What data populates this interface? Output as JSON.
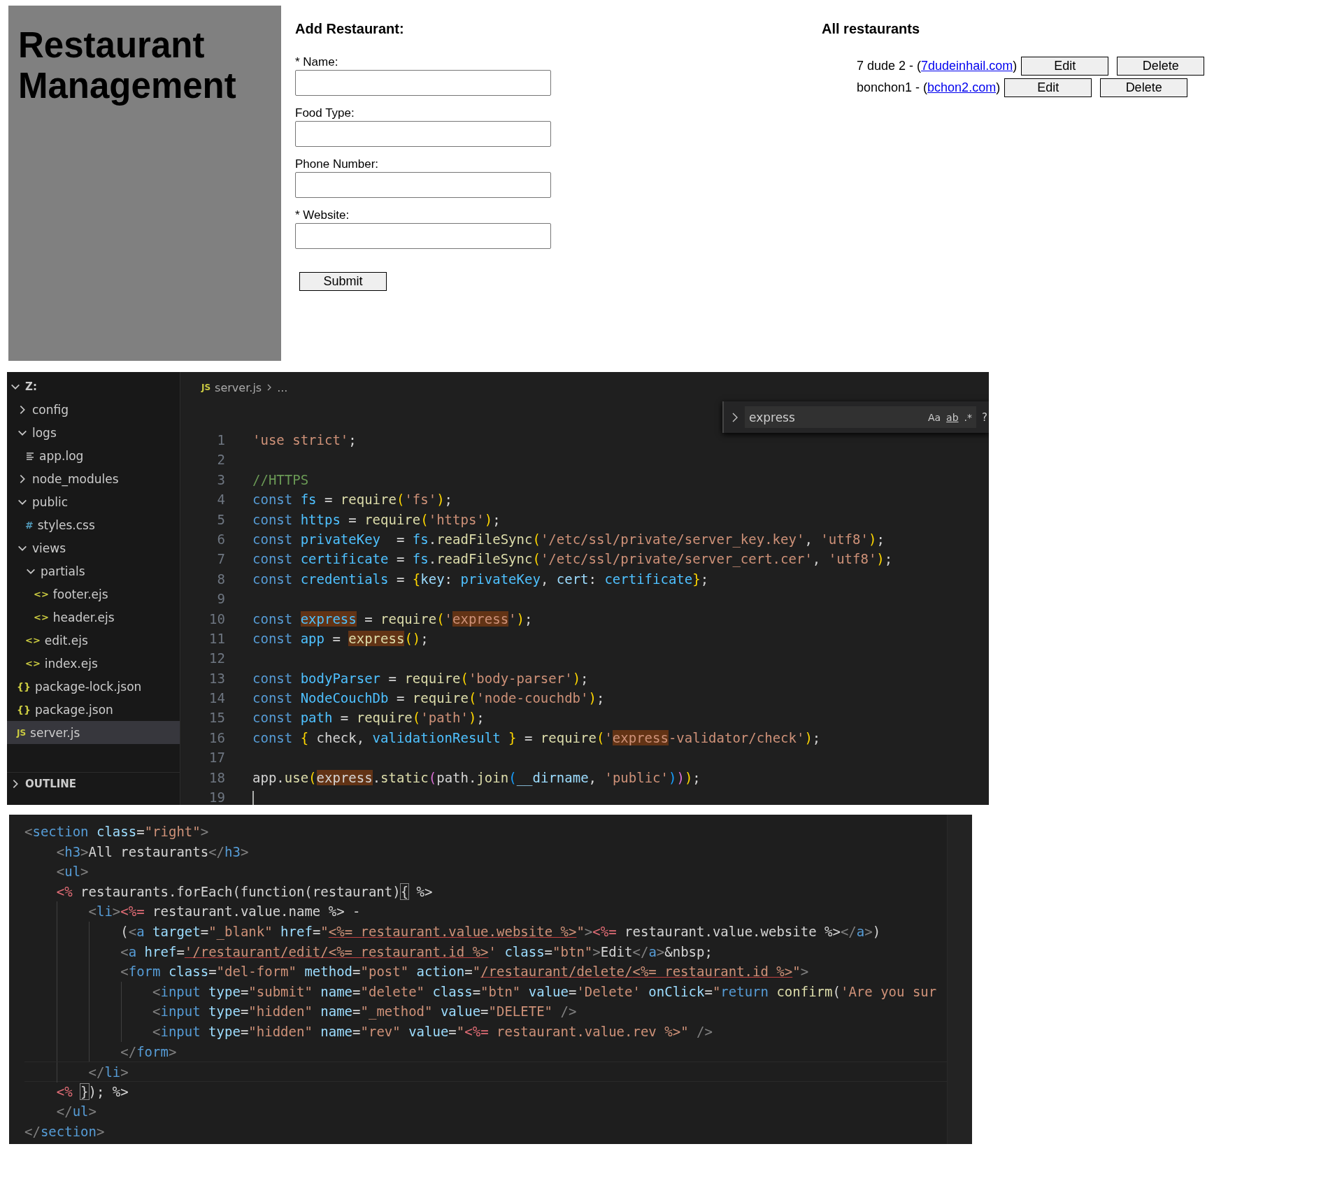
{
  "page": {
    "title": "Restaurant Management",
    "add_form": {
      "heading": "Add Restaurant:",
      "fields": [
        {
          "label": "* Name:"
        },
        {
          "label": "Food Type:"
        },
        {
          "label": "Phone Number:"
        },
        {
          "label": "* Website:"
        }
      ],
      "submit": "Submit"
    },
    "restaurants": {
      "heading": "All restaurants",
      "items": [
        {
          "label": "7 dude 2 - (",
          "website": "7dudeinhail.com",
          "suffix": ")",
          "edit": "Edit",
          "delete": "Delete"
        },
        {
          "label": "bonchon1 - (",
          "website": "bchon2.com",
          "suffix": ")",
          "edit": "Edit",
          "delete": "Delete"
        }
      ]
    }
  },
  "editor": {
    "explorer": {
      "root": {
        "label": "Z:",
        "expanded": true
      },
      "items": [
        {
          "label": "config",
          "kind": "folder",
          "expanded": false,
          "selected": false
        },
        {
          "label": "logs",
          "kind": "folder",
          "expanded": true,
          "selected": false,
          "children": [
            {
              "label": "app.log",
              "kind": "log",
              "selected": false
            }
          ]
        },
        {
          "label": "node_modules",
          "kind": "folder",
          "expanded": false,
          "selected": false
        },
        {
          "label": "public",
          "kind": "folder",
          "expanded": true,
          "selected": false,
          "children": [
            {
              "label": "styles.css",
              "kind": "css",
              "glyph": "#",
              "selected": false
            }
          ]
        },
        {
          "label": "views",
          "kind": "folder",
          "expanded": true,
          "selected": false,
          "children": [
            {
              "label": "partials",
              "kind": "folder",
              "expanded": true,
              "selected": false,
              "children": [
                {
                  "label": "footer.ejs",
                  "kind": "ejs",
                  "glyph": "<>",
                  "selected": false
                },
                {
                  "label": "header.ejs",
                  "kind": "ejs",
                  "glyph": "<>",
                  "selected": false
                }
              ]
            },
            {
              "label": "edit.ejs",
              "kind": "ejs",
              "glyph": "<>",
              "selected": false
            },
            {
              "label": "index.ejs",
              "kind": "ejs",
              "glyph": "<>",
              "selected": false
            }
          ]
        },
        {
          "label": "package-lock.json",
          "kind": "json",
          "glyph": "{}",
          "selected": false
        },
        {
          "label": "package.json",
          "kind": "json",
          "glyph": "{}",
          "selected": false
        },
        {
          "label": "server.js",
          "kind": "js",
          "glyph": "JS",
          "selected": true
        }
      ],
      "outline": {
        "label": "OUTLINE",
        "expanded": false
      }
    },
    "breadcrumb": {
      "glyph": "JS",
      "file": "server.js",
      "rest": "..."
    },
    "find": {
      "query": "express",
      "options": [
        {
          "label": "Aa",
          "kind": "case"
        },
        {
          "label": "ab",
          "kind": "word"
        },
        {
          "label": ".*",
          "kind": "regex"
        }
      ],
      "result": "?"
    },
    "lines": [
      {
        "n": "1",
        "tokens": [
          {
            "text": "'use strict'",
            "kind": "str"
          },
          {
            "text": ";",
            "kind": "pl"
          }
        ]
      },
      {
        "n": "2"
      },
      {
        "n": "3",
        "tokens": [
          {
            "text": "//HTTPS",
            "kind": "cm"
          }
        ]
      },
      {
        "n": "4",
        "tokens": [
          {
            "text": "const",
            "kind": "kw"
          },
          {
            "text": " fs",
            "kind": "var"
          },
          {
            "text": " = ",
            "kind": "pl"
          },
          {
            "text": "require",
            "kind": "fn"
          },
          {
            "text": "(",
            "kind": "p1"
          },
          {
            "text": "'fs'",
            "kind": "str"
          },
          {
            "text": ")",
            "kind": "p1"
          },
          {
            "text": ";",
            "kind": "pl"
          }
        ]
      },
      {
        "n": "5",
        "tokens": [
          {
            "text": "const",
            "kind": "kw"
          },
          {
            "text": " https",
            "kind": "var"
          },
          {
            "text": " = ",
            "kind": "pl"
          },
          {
            "text": "require",
            "kind": "fn"
          },
          {
            "text": "(",
            "kind": "p1"
          },
          {
            "text": "'https'",
            "kind": "str"
          },
          {
            "text": ")",
            "kind": "p1"
          },
          {
            "text": ";",
            "kind": "pl"
          }
        ]
      },
      {
        "n": "6",
        "tokens": [
          {
            "text": "const",
            "kind": "kw"
          },
          {
            "text": " privateKey",
            "kind": "var"
          },
          {
            "text": "  = ",
            "kind": "pl"
          },
          {
            "text": "fs",
            "kind": "var"
          },
          {
            "text": ".",
            "kind": "pl"
          },
          {
            "text": "readFileSync",
            "kind": "fn"
          },
          {
            "text": "(",
            "kind": "p1"
          },
          {
            "text": "'/etc/ssl/private/server_key.key'",
            "kind": "str"
          },
          {
            "text": ", ",
            "kind": "pl"
          },
          {
            "text": "'utf8'",
            "kind": "str"
          },
          {
            "text": ")",
            "kind": "p1"
          },
          {
            "text": ";",
            "kind": "pl"
          }
        ]
      },
      {
        "n": "7",
        "tokens": [
          {
            "text": "const",
            "kind": "kw"
          },
          {
            "text": " certificate",
            "kind": "var"
          },
          {
            "text": " = ",
            "kind": "pl"
          },
          {
            "text": "fs",
            "kind": "var"
          },
          {
            "text": ".",
            "kind": "pl"
          },
          {
            "text": "readFileSync",
            "kind": "fn"
          },
          {
            "text": "(",
            "kind": "p1"
          },
          {
            "text": "'/etc/ssl/private/server_cert.cer'",
            "kind": "str"
          },
          {
            "text": ", ",
            "kind": "pl"
          },
          {
            "text": "'utf8'",
            "kind": "str"
          },
          {
            "text": ")",
            "kind": "p1"
          },
          {
            "text": ";",
            "kind": "pl"
          }
        ]
      },
      {
        "n": "8",
        "tokens": [
          {
            "text": "const",
            "kind": "kw"
          },
          {
            "text": " credentials",
            "kind": "var"
          },
          {
            "text": " = ",
            "kind": "pl"
          },
          {
            "text": "{",
            "kind": "p1"
          },
          {
            "text": "key",
            "kind": "prop"
          },
          {
            "text": ": ",
            "kind": "pl"
          },
          {
            "text": "privateKey",
            "kind": "var"
          },
          {
            "text": ", ",
            "kind": "pl"
          },
          {
            "text": "cert",
            "kind": "prop"
          },
          {
            "text": ": ",
            "kind": "pl"
          },
          {
            "text": "certificate",
            "kind": "var"
          },
          {
            "text": "}",
            "kind": "p1"
          },
          {
            "text": ";",
            "kind": "pl"
          }
        ]
      },
      {
        "n": "9"
      },
      {
        "n": "10",
        "tokens": [
          {
            "text": "const ",
            "kind": "kw"
          },
          {
            "text": "express",
            "kind": "var-hl"
          },
          {
            "text": " = ",
            "kind": "pl"
          },
          {
            "text": "require",
            "kind": "fn"
          },
          {
            "text": "(",
            "kind": "p1"
          },
          {
            "text": "'",
            "kind": "str"
          },
          {
            "text": "express",
            "kind": "str-hl"
          },
          {
            "text": "'",
            "kind": "str"
          },
          {
            "text": ")",
            "kind": "p1"
          },
          {
            "text": ";",
            "kind": "pl"
          }
        ]
      },
      {
        "n": "11",
        "tokens": [
          {
            "text": "const",
            "kind": "kw"
          },
          {
            "text": " app",
            "kind": "var"
          },
          {
            "text": " = ",
            "kind": "pl"
          },
          {
            "text": "express",
            "kind": "fn-hl"
          },
          {
            "text": "()",
            "kind": "p1"
          },
          {
            "text": ";",
            "kind": "pl"
          }
        ]
      },
      {
        "n": "12"
      },
      {
        "n": "13",
        "tokens": [
          {
            "text": "const",
            "kind": "kw"
          },
          {
            "text": " bodyParser",
            "kind": "var"
          },
          {
            "text": " = ",
            "kind": "pl"
          },
          {
            "text": "require",
            "kind": "fn"
          },
          {
            "text": "(",
            "kind": "p1"
          },
          {
            "text": "'body-parser'",
            "kind": "str"
          },
          {
            "text": ")",
            "kind": "p1"
          },
          {
            "text": ";",
            "kind": "pl"
          }
        ]
      },
      {
        "n": "14",
        "tokens": [
          {
            "text": "const",
            "kind": "kw"
          },
          {
            "text": " NodeCouchDb",
            "kind": "var"
          },
          {
            "text": " = ",
            "kind": "pl"
          },
          {
            "text": "require",
            "kind": "fn"
          },
          {
            "text": "(",
            "kind": "p1"
          },
          {
            "text": "'node-couchdb'",
            "kind": "str"
          },
          {
            "text": ")",
            "kind": "p1"
          },
          {
            "text": ";",
            "kind": "pl"
          }
        ]
      },
      {
        "n": "15",
        "tokens": [
          {
            "text": "const",
            "kind": "kw"
          },
          {
            "text": " path",
            "kind": "var"
          },
          {
            "text": " = ",
            "kind": "pl"
          },
          {
            "text": "require",
            "kind": "fn"
          },
          {
            "text": "(",
            "kind": "p1"
          },
          {
            "text": "'path'",
            "kind": "str"
          },
          {
            "text": ")",
            "kind": "p1"
          },
          {
            "text": ";",
            "kind": "pl"
          }
        ]
      },
      {
        "n": "16",
        "tokens": [
          {
            "text": "const ",
            "kind": "kw"
          },
          {
            "text": "{",
            "kind": "p1"
          },
          {
            "text": " check, ",
            "kind": "pl"
          },
          {
            "text": "validationResult ",
            "kind": "var"
          },
          {
            "text": "}",
            "kind": "p1"
          },
          {
            "text": " = ",
            "kind": "pl"
          },
          {
            "text": "require",
            "kind": "fn"
          },
          {
            "text": "(",
            "kind": "p1"
          },
          {
            "text": "'",
            "kind": "str"
          },
          {
            "text": "express",
            "kind": "str-hl"
          },
          {
            "text": "-validator/check'",
            "kind": "str"
          },
          {
            "text": ")",
            "kind": "p1"
          },
          {
            "text": ";",
            "kind": "pl"
          }
        ]
      },
      {
        "n": "17"
      },
      {
        "n": "18",
        "tokens": [
          {
            "text": "app",
            "kind": "pl"
          },
          {
            "text": ".",
            "kind": "pl"
          },
          {
            "text": "use",
            "kind": "fn"
          },
          {
            "text": "(",
            "kind": "p1"
          },
          {
            "text": "express",
            "kind": "pl-hl"
          },
          {
            "text": ".",
            "kind": "pl"
          },
          {
            "text": "static",
            "kind": "fn"
          },
          {
            "text": "(",
            "kind": "p2"
          },
          {
            "text": "path",
            "kind": "pl"
          },
          {
            "text": ".",
            "kind": "pl"
          },
          {
            "text": "join",
            "kind": "fn"
          },
          {
            "text": "(",
            "kind": "p3"
          },
          {
            "text": "__dirname",
            "kind": "prop"
          },
          {
            "text": ", ",
            "kind": "pl"
          },
          {
            "text": "'public'",
            "kind": "str"
          },
          {
            "text": ")",
            "kind": "p3"
          },
          {
            "text": ")",
            "kind": "p2"
          },
          {
            "text": ")",
            "kind": "p1"
          },
          {
            "text": ";",
            "kind": "pl"
          }
        ]
      },
      {
        "n": "19"
      }
    ]
  },
  "template": {
    "lines": [
      {
        "current": false,
        "tokens": [
          {
            "text": "<",
            "kind": "tp"
          },
          {
            "text": "section",
            "kind": "tag"
          },
          {
            "text": " class",
            "kind": "attr"
          },
          {
            "text": "=",
            "kind": "pl"
          },
          {
            "text": "\"right\"",
            "kind": "str"
          },
          {
            "text": ">",
            "kind": "tp"
          }
        ]
      },
      {
        "current": false,
        "tokens": [
          {
            "text": "    <",
            "kind": "tp"
          },
          {
            "text": "h3",
            "kind": "tag"
          },
          {
            "text": ">",
            "kind": "tp"
          },
          {
            "text": "All restaurants",
            "kind": "pl"
          },
          {
            "text": "</",
            "kind": "tp"
          },
          {
            "text": "h3",
            "kind": "tag"
          },
          {
            "text": ">",
            "kind": "tp"
          }
        ]
      },
      {
        "current": false,
        "tokens": [
          {
            "text": "    <",
            "kind": "tp"
          },
          {
            "text": "ul",
            "kind": "tag"
          },
          {
            "text": ">",
            "kind": "tp"
          }
        ]
      },
      {
        "current": false,
        "tokens": [
          {
            "text": "    <%",
            "kind": "ejs"
          },
          {
            "text": " restaurants.forEach(function(restaurant)",
            "kind": "pl"
          },
          {
            "text": "{",
            "kind": "box"
          },
          {
            "text": " %>",
            "kind": "pl"
          }
        ]
      },
      {
        "current": false,
        "tokens": [
          {
            "text": "        <",
            "kind": "tp"
          },
          {
            "text": "li",
            "kind": "tag"
          },
          {
            "text": ">",
            "kind": "tp"
          },
          {
            "text": "<%=",
            "kind": "ejs"
          },
          {
            "text": " restaurant.value.name %> -",
            "kind": "pl"
          }
        ]
      },
      {
        "current": false,
        "tokens": [
          {
            "text": "            (",
            "kind": "pl"
          },
          {
            "text": "<",
            "kind": "tp"
          },
          {
            "text": "a",
            "kind": "tag"
          },
          {
            "text": " target",
            "kind": "attr"
          },
          {
            "text": "=",
            "kind": "pl"
          },
          {
            "text": "\"_blank\"",
            "kind": "str"
          },
          {
            "text": " href",
            "kind": "attr"
          },
          {
            "text": "=",
            "kind": "pl"
          },
          {
            "text": "\"",
            "kind": "str"
          },
          {
            "text": "<%= restaurant.value.website %>",
            "kind": "ejsstr"
          },
          {
            "text": "\"",
            "kind": "str"
          },
          {
            "text": ">",
            "kind": "tp"
          },
          {
            "text": "<%=",
            "kind": "ejs"
          },
          {
            "text": " restaurant.value.website %>",
            "kind": "pl"
          },
          {
            "text": "</",
            "kind": "tp"
          },
          {
            "text": "a",
            "kind": "tag"
          },
          {
            "text": ">",
            "kind": "tp"
          },
          {
            "text": ")",
            "kind": "pl"
          }
        ]
      },
      {
        "current": false,
        "tokens": [
          {
            "text": "            <",
            "kind": "tp"
          },
          {
            "text": "a",
            "kind": "tag"
          },
          {
            "text": " href",
            "kind": "attr"
          },
          {
            "text": "=",
            "kind": "pl"
          },
          {
            "text": "'/restaurant/edit/",
            "kind": "ustr"
          },
          {
            "text": "<%= restaurant.id %>",
            "kind": "ejsstr"
          },
          {
            "text": "'",
            "kind": "str"
          },
          {
            "text": " class",
            "kind": "attr"
          },
          {
            "text": "=",
            "kind": "pl"
          },
          {
            "text": "\"btn\"",
            "kind": "str"
          },
          {
            "text": ">",
            "kind": "tp"
          },
          {
            "text": "Edit",
            "kind": "pl"
          },
          {
            "text": "</",
            "kind": "tp"
          },
          {
            "text": "a",
            "kind": "tag"
          },
          {
            "text": ">",
            "kind": "tp"
          },
          {
            "text": "&nbsp;",
            "kind": "ent"
          }
        ]
      },
      {
        "current": false,
        "tokens": [
          {
            "text": "            <",
            "kind": "tp"
          },
          {
            "text": "form",
            "kind": "tag"
          },
          {
            "text": " class",
            "kind": "attr"
          },
          {
            "text": "=",
            "kind": "pl"
          },
          {
            "text": "\"del-form\"",
            "kind": "str"
          },
          {
            "text": " method",
            "kind": "attr"
          },
          {
            "text": "=",
            "kind": "pl"
          },
          {
            "text": "\"post\"",
            "kind": "str"
          },
          {
            "text": " action",
            "kind": "attr"
          },
          {
            "text": "=",
            "kind": "pl"
          },
          {
            "text": "\"",
            "kind": "str"
          },
          {
            "text": "/restaurant/delete/",
            "kind": "ustr"
          },
          {
            "text": "<%= restaurant.id %>",
            "kind": "ejsstr"
          },
          {
            "text": "\"",
            "kind": "str"
          },
          {
            "text": ">",
            "kind": "tp"
          }
        ]
      },
      {
        "current": false,
        "tokens": [
          {
            "text": "                <",
            "kind": "tp"
          },
          {
            "text": "input",
            "kind": "tag"
          },
          {
            "text": " type",
            "kind": "attr"
          },
          {
            "text": "=",
            "kind": "pl"
          },
          {
            "text": "\"submit\"",
            "kind": "str"
          },
          {
            "text": " name",
            "kind": "attr"
          },
          {
            "text": "=",
            "kind": "pl"
          },
          {
            "text": "\"delete\"",
            "kind": "str"
          },
          {
            "text": " class",
            "kind": "attr"
          },
          {
            "text": "=",
            "kind": "pl"
          },
          {
            "text": "\"btn\"",
            "kind": "str"
          },
          {
            "text": " value",
            "kind": "attr"
          },
          {
            "text": "=",
            "kind": "pl"
          },
          {
            "text": "'Delete'",
            "kind": "str"
          },
          {
            "text": " onClick",
            "kind": "attr"
          },
          {
            "text": "=",
            "kind": "pl"
          },
          {
            "text": "\"",
            "kind": "str"
          },
          {
            "text": "return ",
            "kind": "kw"
          },
          {
            "text": "confirm",
            "kind": "fn"
          },
          {
            "text": "(",
            "kind": "pl"
          },
          {
            "text": "'Are you sur",
            "kind": "str"
          }
        ]
      },
      {
        "current": false,
        "tokens": [
          {
            "text": "                <",
            "kind": "tp"
          },
          {
            "text": "input",
            "kind": "tag"
          },
          {
            "text": " type",
            "kind": "attr"
          },
          {
            "text": "=",
            "kind": "pl"
          },
          {
            "text": "\"hidden\"",
            "kind": "str"
          },
          {
            "text": " name",
            "kind": "attr"
          },
          {
            "text": "=",
            "kind": "pl"
          },
          {
            "text": "\"_method\"",
            "kind": "str"
          },
          {
            "text": " value",
            "kind": "attr"
          },
          {
            "text": "=",
            "kind": "pl"
          },
          {
            "text": "\"DELETE\"",
            "kind": "str"
          },
          {
            "text": " />",
            "kind": "tp"
          }
        ]
      },
      {
        "current": false,
        "tokens": [
          {
            "text": "                <",
            "kind": "tp"
          },
          {
            "text": "input",
            "kind": "tag"
          },
          {
            "text": " type",
            "kind": "attr"
          },
          {
            "text": "=",
            "kind": "pl"
          },
          {
            "text": "\"hidden\"",
            "kind": "str"
          },
          {
            "text": " name",
            "kind": "attr"
          },
          {
            "text": "=",
            "kind": "pl"
          },
          {
            "text": "\"rev\"",
            "kind": "str"
          },
          {
            "text": " value",
            "kind": "attr"
          },
          {
            "text": "=",
            "kind": "pl"
          },
          {
            "text": "\"",
            "kind": "str"
          },
          {
            "text": "<%=",
            "kind": "ejs"
          },
          {
            "text": " restaurant.value.rev %>",
            "kind": "str"
          },
          {
            "text": "\"",
            "kind": "str"
          },
          {
            "text": " />",
            "kind": "tp"
          }
        ]
      },
      {
        "current": false,
        "tokens": [
          {
            "text": "            </",
            "kind": "tp"
          },
          {
            "text": "form",
            "kind": "tag"
          },
          {
            "text": ">",
            "kind": "tp"
          }
        ]
      },
      {
        "current": true,
        "tokens": [
          {
            "text": "        </",
            "kind": "tp"
          },
          {
            "text": "li",
            "kind": "tag"
          },
          {
            "text": ">",
            "kind": "tp"
          }
        ]
      },
      {
        "current": false,
        "tokens": [
          {
            "text": "    <% ",
            "kind": "ejs"
          },
          {
            "text": "}",
            "kind": "box"
          },
          {
            "text": "); %>",
            "kind": "pl"
          }
        ]
      },
      {
        "current": false,
        "tokens": [
          {
            "text": "    </",
            "kind": "tp"
          },
          {
            "text": "ul",
            "kind": "tag"
          },
          {
            "text": ">",
            "kind": "tp"
          }
        ]
      },
      {
        "current": false,
        "tokens": [
          {
            "text": "</",
            "kind": "tp"
          },
          {
            "text": "section",
            "kind": "tag"
          },
          {
            "text": ">",
            "kind": "tp"
          }
        ]
      }
    ]
  }
}
